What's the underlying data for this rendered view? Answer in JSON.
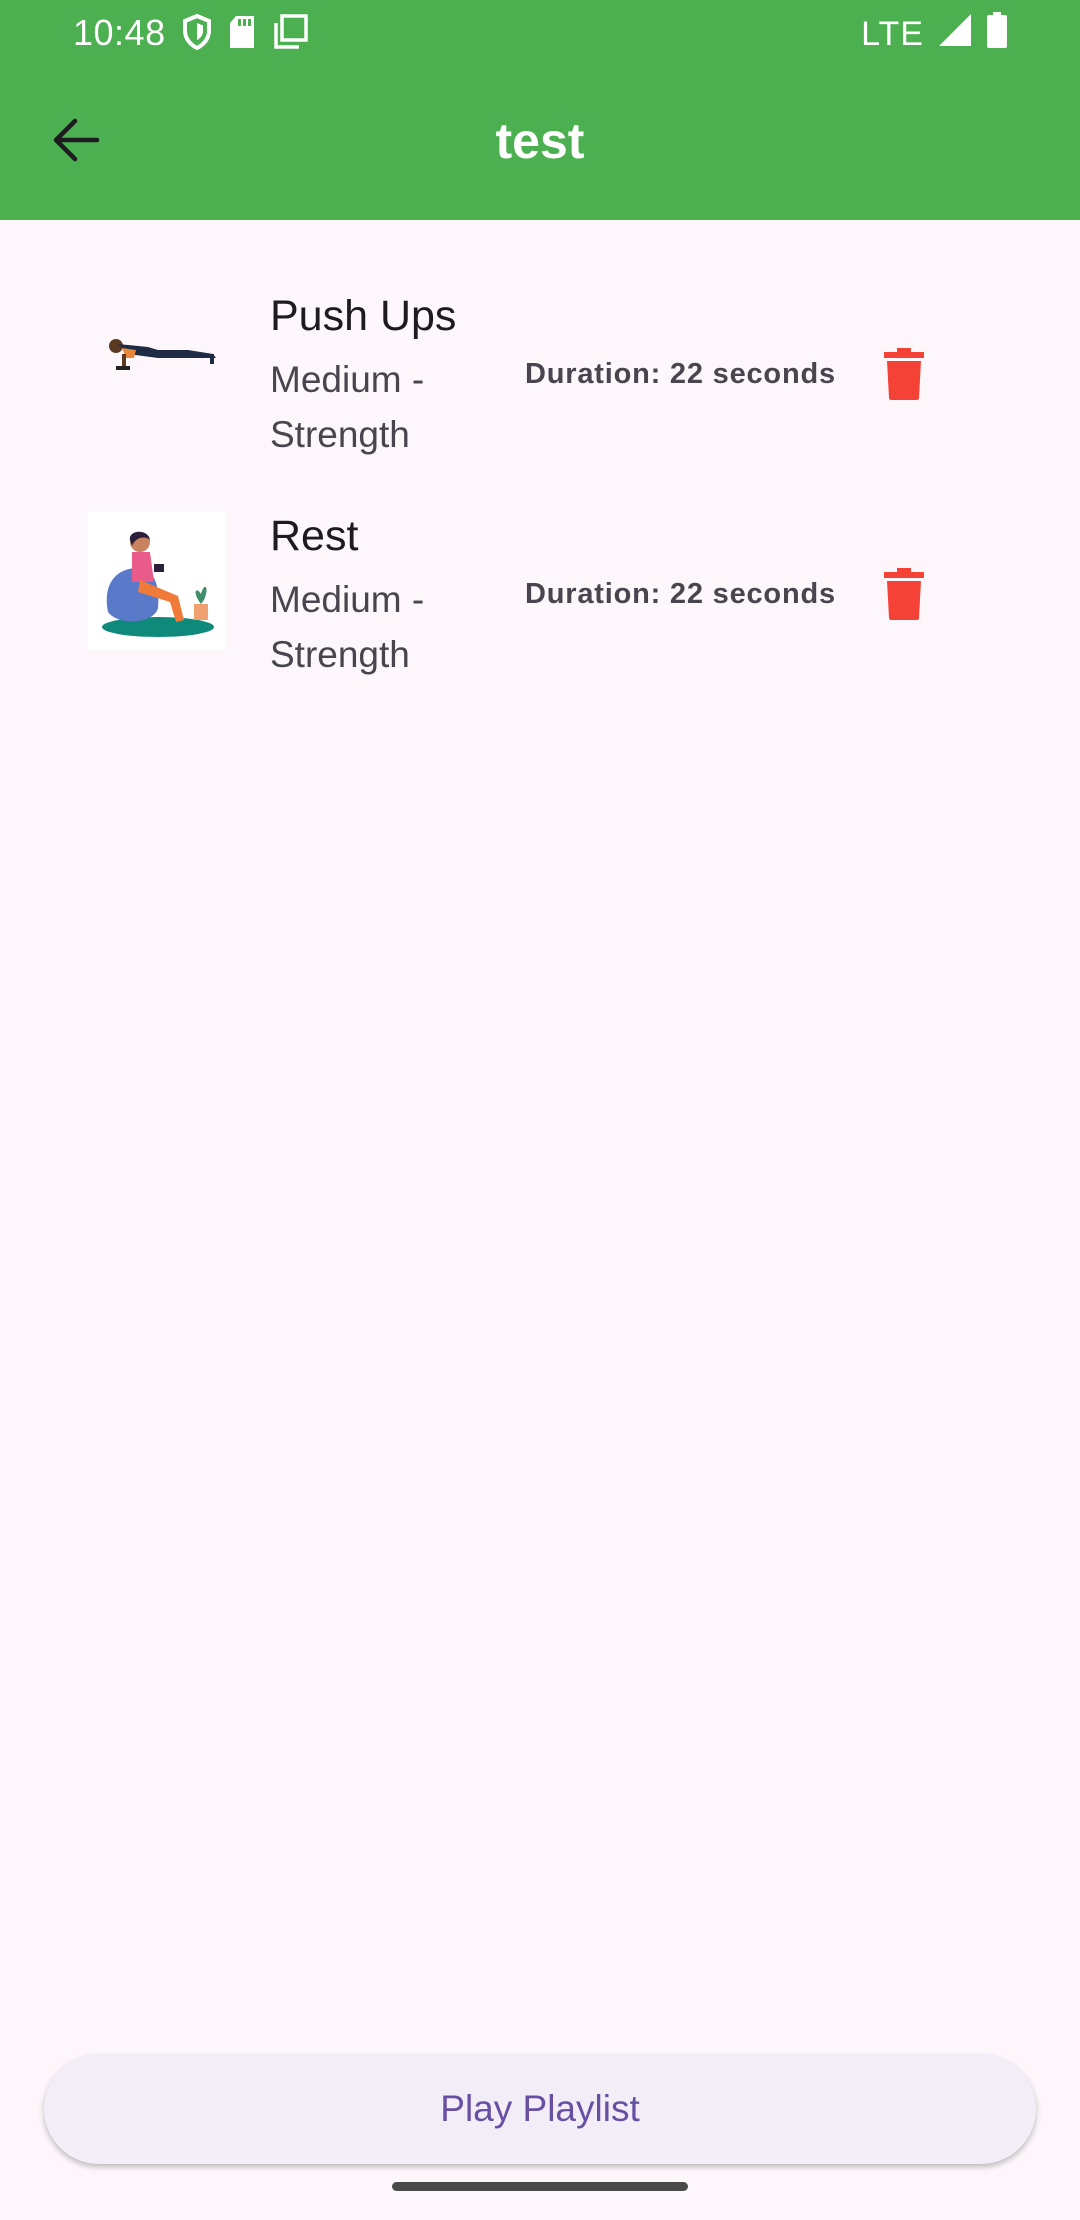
{
  "status": {
    "time": "10:48",
    "network": "LTE",
    "icons_left": [
      "shield-icon",
      "sd-card-icon",
      "copy-icon"
    ],
    "icons_right": [
      "signal-icon",
      "battery-icon"
    ]
  },
  "appbar": {
    "title": "test",
    "back_icon": "arrow-back-icon",
    "color": "#4CAF50"
  },
  "items": [
    {
      "name": "Push Ups",
      "subtitle": "Medium - Strength",
      "duration": "Duration: 22 seconds",
      "thumb_icon": "push-ups-illustration"
    },
    {
      "name": "Rest",
      "subtitle": "Medium - Strength",
      "duration": "Duration: 22 seconds",
      "thumb_icon": "rest-illustration"
    }
  ],
  "actions": {
    "delete_icon": "trash-icon",
    "delete_color": "#F44336",
    "play_label": "Play Playlist"
  }
}
